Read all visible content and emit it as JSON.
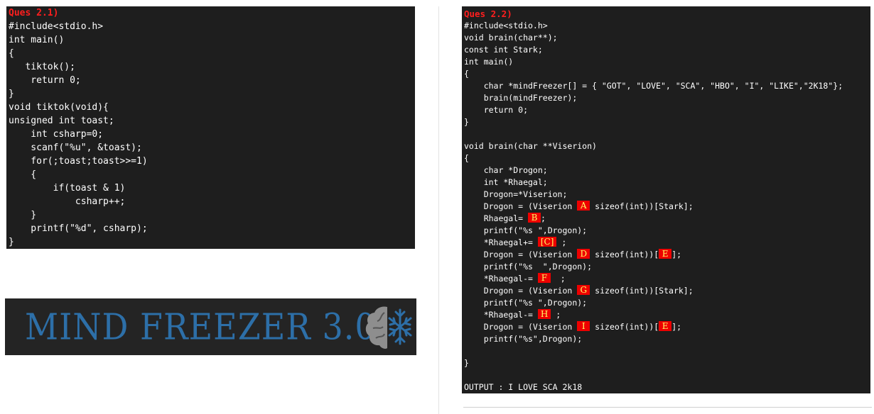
{
  "left_panel": {
    "title": "Ques 2.1)",
    "lines": [
      "#include<stdio.h>",
      "int main()",
      "{",
      "   tiktok();",
      "    return 0;",
      "}",
      "void tiktok(void){",
      "unsigned int toast;",
      "    int csharp=0;",
      "    scanf(\"%u\", &toast);",
      "    for(;toast;toast>>=1)",
      "    {",
      "        if(toast & 1)",
      "            csharp++;",
      "    }",
      "    printf(\"%d\", csharp);",
      "}"
    ]
  },
  "banner": {
    "text": "MIND FREEZER 3.0",
    "icon": "brain-snowflake-icon"
  },
  "right_panel": {
    "title": "Ques 2.2)",
    "lines": [
      "#include<stdio.h>",
      "void brain(char**);",
      "const int Stark;",
      "int main()",
      "{",
      "    char *mindFreezer[] = { \"GOT\", \"LOVE\", \"SCA\", \"HBO\", \"I\", \"LIKE\",\"2K18\"};",
      "    brain(mindFreezer);",
      "    return 0;",
      "}",
      "",
      "void brain(char **Viserion)",
      "{",
      "    char *Drogon;",
      "    int *Rhaegal;",
      "    Drogon=*Viserion;"
    ],
    "blank_box_lines": {
      "l15a": "    Drogon = (Viserion ",
      "l15b": " sizeof(int))[Stark];",
      "l16a": "    Rhaegal= ",
      "l16b": ";",
      "l17": "    printf(\"%s \",Drogon);",
      "l18a": "    *Rhaegal+= ",
      "l18b": " ;",
      "l19a": "    Drogon = (Viserion ",
      "l19b": " sizeof(int))[",
      "l19c": "];",
      "l20": "    printf(\"%s  \",Drogon);",
      "l21a": "    *Rhaegal-= ",
      "l21b": "  ;",
      "l22a": "    Drogon = (Viserion ",
      "l22b": " sizeof(int))[Stark];",
      "l23": "    printf(\"%s \",Drogon);",
      "l24a": "    *Rhaegal-= ",
      "l24b": " ;",
      "l25a": "    Drogon = (Viserion ",
      "l25b": " sizeof(int))[",
      "l25c": "];",
      "l26": "    printf(\"%s\",Drogon);",
      "l27": "",
      "l28": "}",
      "l29": "",
      "l30": "OUTPUT : I LOVE SCA 2k18"
    },
    "blanks": {
      "A": "A",
      "B": "B",
      "C": "[C]",
      "D": "D",
      "E": "E",
      "F": "F",
      "G": "G",
      "H": "H",
      "I": "I"
    },
    "colors": {
      "blank_bg": "#ee0000",
      "blank_text": "#ffff66",
      "title": "#ff1e1e",
      "panel_bg": "#1e1e1e"
    }
  }
}
